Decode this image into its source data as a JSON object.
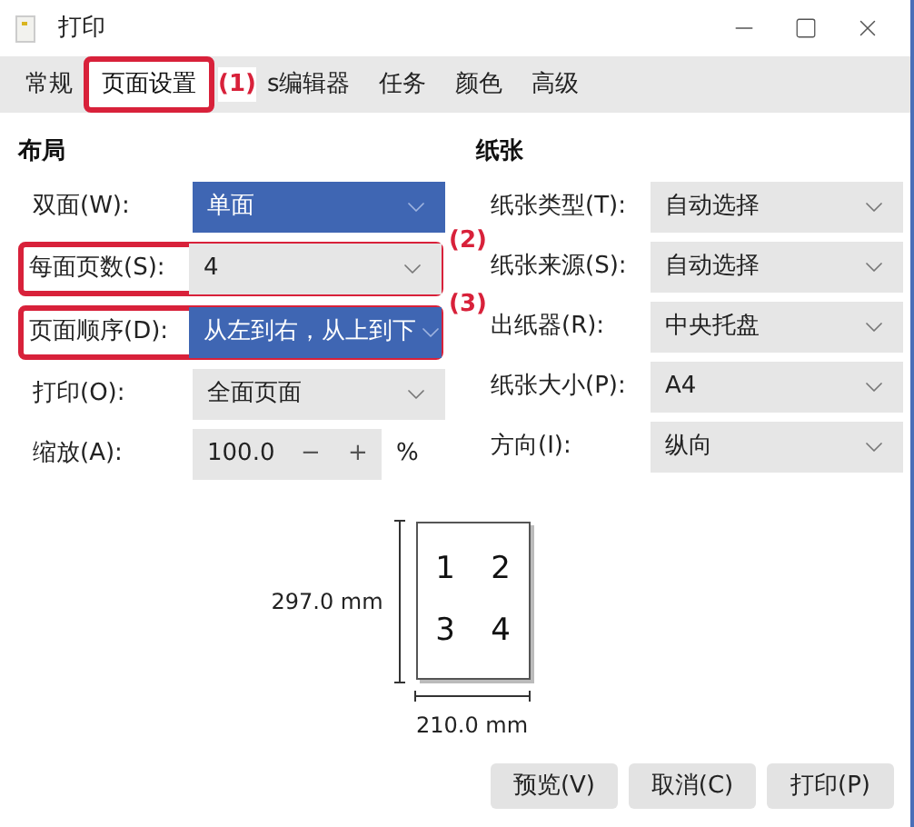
{
  "window": {
    "title": "打印"
  },
  "tabs": [
    {
      "label": "常规",
      "selected": false
    },
    {
      "label": "页面设置",
      "selected": true,
      "callout": "(1)"
    },
    {
      "label": "s编辑器",
      "selected": false
    },
    {
      "label": "任务",
      "selected": false
    },
    {
      "label": "颜色",
      "selected": false
    },
    {
      "label": "高级",
      "selected": false
    }
  ],
  "layout": {
    "heading": "布局",
    "rows": [
      {
        "kind": "select",
        "label": "双面(W):",
        "value": "单面",
        "highlighted": true
      },
      {
        "kind": "select",
        "label": "每面页数(S):",
        "value": "4",
        "highlighted": false,
        "callout": "(2)"
      },
      {
        "kind": "select",
        "label": "页面顺序(D):",
        "value": "从左到右，从上到下",
        "highlighted": true,
        "callout": "(3)"
      },
      {
        "kind": "select",
        "label": "打印(O):",
        "value": "全面页面",
        "highlighted": false
      },
      {
        "kind": "spin",
        "label": "缩放(A):",
        "value": "100.0",
        "minus": "−",
        "plus": "+",
        "unit": "%"
      }
    ]
  },
  "paper": {
    "heading": "纸张",
    "rows": [
      {
        "label": "纸张类型(T):",
        "value": "自动选择"
      },
      {
        "label": "纸张来源(S):",
        "value": "自动选择"
      },
      {
        "label": "出纸器(R):",
        "value": "中央托盘"
      },
      {
        "label": "纸张大小(P):",
        "value": "A4"
      },
      {
        "label": "方向(I):",
        "value": "纵向"
      }
    ]
  },
  "preview": {
    "pages": [
      "1",
      "2",
      "3",
      "4"
    ],
    "height": "297.0 mm",
    "width": "210.0 mm"
  },
  "buttons": [
    "预览(V)",
    "取消(C)",
    "打印(P)"
  ]
}
